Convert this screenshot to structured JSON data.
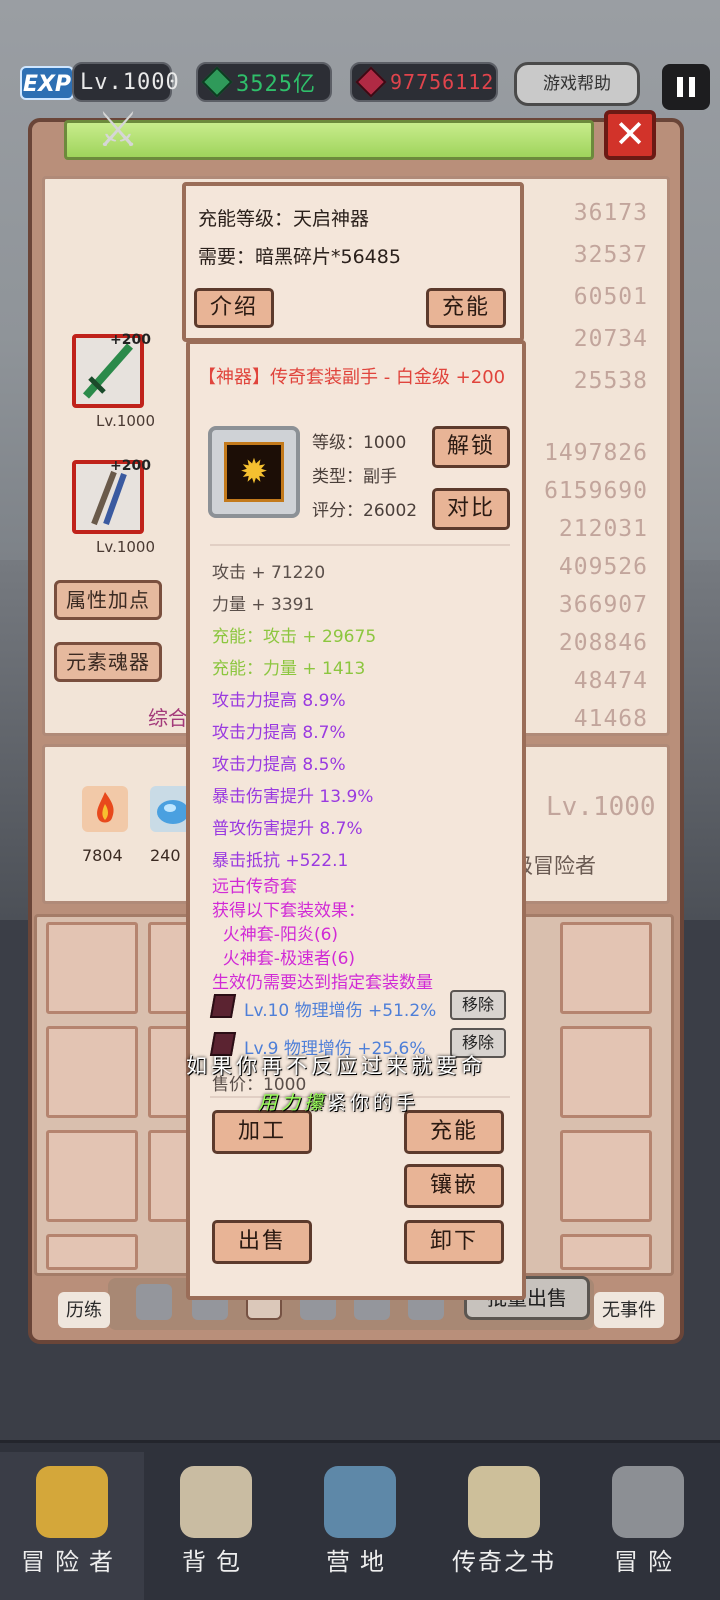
{
  "hud": {
    "exp_badge": "EXP",
    "level": "Lv.1000",
    "green_gem_amount": "3525亿",
    "red_gem_amount": "97756112",
    "help_button": "游戏帮助",
    "pause_icon": "pause-icon",
    "colors": {
      "green": "#2fbf6a",
      "red": "#e0444c"
    }
  },
  "character_panel": {
    "close_icon": "close-icon",
    "stats_top": [
      "36173",
      "32537",
      "60501",
      "20734",
      "25538"
    ],
    "stats_bottom": [
      "1497826",
      "6159690",
      "212031",
      "409526",
      "366907",
      "208846",
      "48474",
      "41468"
    ],
    "equipment": [
      {
        "name": "weapon",
        "plus": "+200",
        "level": "Lv.1000",
        "icon": "green-sword-icon"
      },
      {
        "name": "accessory",
        "plus": "+200",
        "level": "Lv.1000",
        "icon": "twin-blade-icon"
      }
    ],
    "buttons": {
      "attribute_points": "属性加点",
      "element_soul": "元素魂器"
    },
    "overall_label": "综合",
    "resources": [
      {
        "icon": "fire-essence-icon",
        "amount": "7804"
      },
      {
        "icon": "water-essence-icon",
        "amount": "240"
      }
    ],
    "player_level": "Lv.1000",
    "rank_title": "级冒险者"
  },
  "charge_popup": {
    "charge_level_label": "充能等级：天启神器",
    "requirement_label": "需要：暗黑碎片*56485",
    "intro_button": "介绍",
    "charge_button": "充能"
  },
  "item_popup": {
    "title": "【神器】传奇套装副手 - 白金级 +200",
    "level": "等级：1000",
    "type": "类型：副手",
    "score": "评分：26002",
    "unlock_button": "解锁",
    "compare_button": "对比",
    "base_stats": [
      "攻击 + 71220",
      "力量 + 3391"
    ],
    "charge_stats": [
      "充能：攻击 + 29675",
      "充能：力量 + 1413"
    ],
    "bonus_stats": [
      "攻击力提高 8.9%",
      "攻击力提高 8.7%",
      "攻击力提高 8.5%",
      "暴击伤害提升 13.9%",
      "普攻伤害提升 8.7%",
      "暴击抵抗 +522.1"
    ],
    "set_info": [
      "远古传奇套",
      "获得以下套装效果：",
      "  火神套-阳炎(6)",
      "  火神套-极速者(6)",
      "生效仍需要达到指定套装数量"
    ],
    "gems": [
      {
        "text": "Lv.10 物理增伤 +51.2%",
        "remove": "移除"
      },
      {
        "text": "Lv.9 物理增伤 +25.6%",
        "remove": "移除"
      }
    ],
    "price": "售价：1000",
    "buttons": {
      "process": "加工",
      "charge": "充能",
      "inlay": "镶嵌",
      "sell": "出售",
      "unequip": "卸下"
    }
  },
  "subtitles": {
    "line1": "如果你再不反应过来就要命",
    "line2_highlight": "用力攥",
    "line2_rest": "紧你的手"
  },
  "inventory_tabs": {
    "left_side": "历练",
    "right_side": "无事件",
    "batch_sell": "批量出售",
    "tab_icons": [
      "sword-tab-icon",
      "armor-tab-icon",
      "helmet-tab-icon",
      "head-tab-icon",
      "chest-tab-icon",
      "ring-tab-icon"
    ]
  },
  "bottom_nav": [
    {
      "label": "冒险者",
      "icon": "crown-icon"
    },
    {
      "label": "背包",
      "icon": "backpack-icon"
    },
    {
      "label": "营地",
      "icon": "camp-banner-icon"
    },
    {
      "label": "传奇之书",
      "icon": "legend-book-icon"
    },
    {
      "label": "冒险",
      "icon": "adventure-sword-icon"
    }
  ]
}
